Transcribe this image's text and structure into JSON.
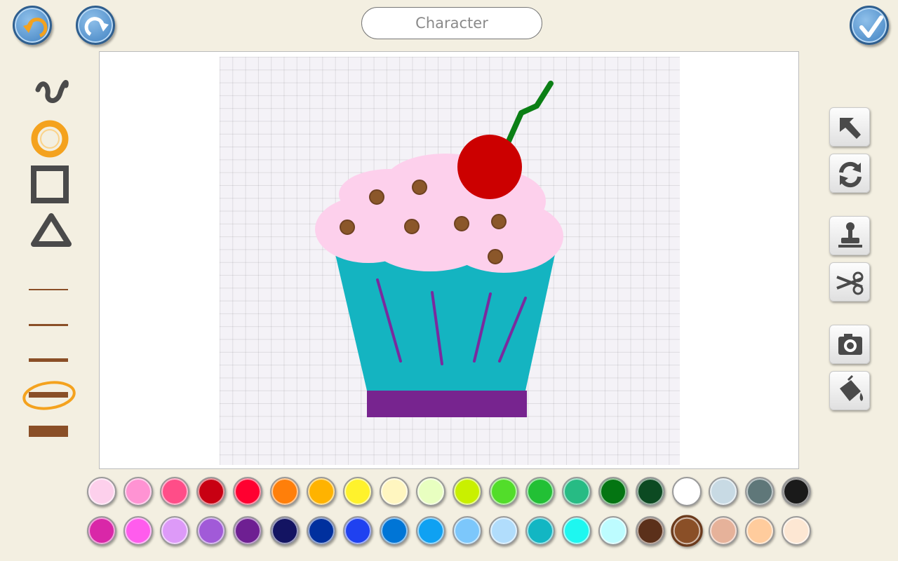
{
  "header": {
    "title_placeholder": "Character",
    "undo_icon": "undo-arrow-icon",
    "redo_icon": "redo-arrow-icon",
    "done_icon": "checkmark-icon"
  },
  "left_tools": {
    "shapes": [
      "freehand-line-icon",
      "ellipse-icon",
      "rectangle-icon",
      "triangle-icon"
    ],
    "line_widths": [
      "thin",
      "thinner",
      "medium",
      "thick",
      "thickest"
    ],
    "selected_shape": "ellipse",
    "selected_line_width": "thick"
  },
  "right_tools": [
    "arrow-select-icon",
    "rotate-icon",
    "stamp-icon",
    "scissors-icon",
    "camera-icon",
    "paint-bucket-icon"
  ],
  "palette": {
    "row1": [
      "#fdd0ec",
      "#ff93d3",
      "#ff4d88",
      "#c80012",
      "#ff0030",
      "#ff7f0a",
      "#ffb300",
      "#fff22c",
      "#fff6c0",
      "#e8ffc0",
      "#c9f000",
      "#52dd2a",
      "#22c035",
      "#27bb84",
      "#047512",
      "#0c4a22",
      "#ffffff",
      "#c8dae4",
      "#5f7779",
      "#1a1a1a"
    ],
    "row2": [
      "#d927a8",
      "#ff5ced",
      "#dd9af8",
      "#a15ad8",
      "#6e1f92",
      "#131462",
      "#00309e",
      "#1f41f0",
      "#0075d6",
      "#0fa1f2",
      "#7cc7fb",
      "#b1ddfc",
      "#12b6c3",
      "#1ef7f0",
      "#bdfcff",
      "#5b301a",
      "#8a4f27",
      "#e6b29a",
      "#ffcc9d",
      "#fde7d3"
    ],
    "selected": "#8a4f27"
  },
  "drawing": {
    "cup_color": "#14b4c1",
    "cup_base_color": "#77248f",
    "frosting_color": "#fdd0ec",
    "cherry_color": "#cc0000",
    "stem_color": "#0b7f15",
    "sprinkle_color": "#8b572a",
    "stripe_color": "#7a2a9e"
  }
}
